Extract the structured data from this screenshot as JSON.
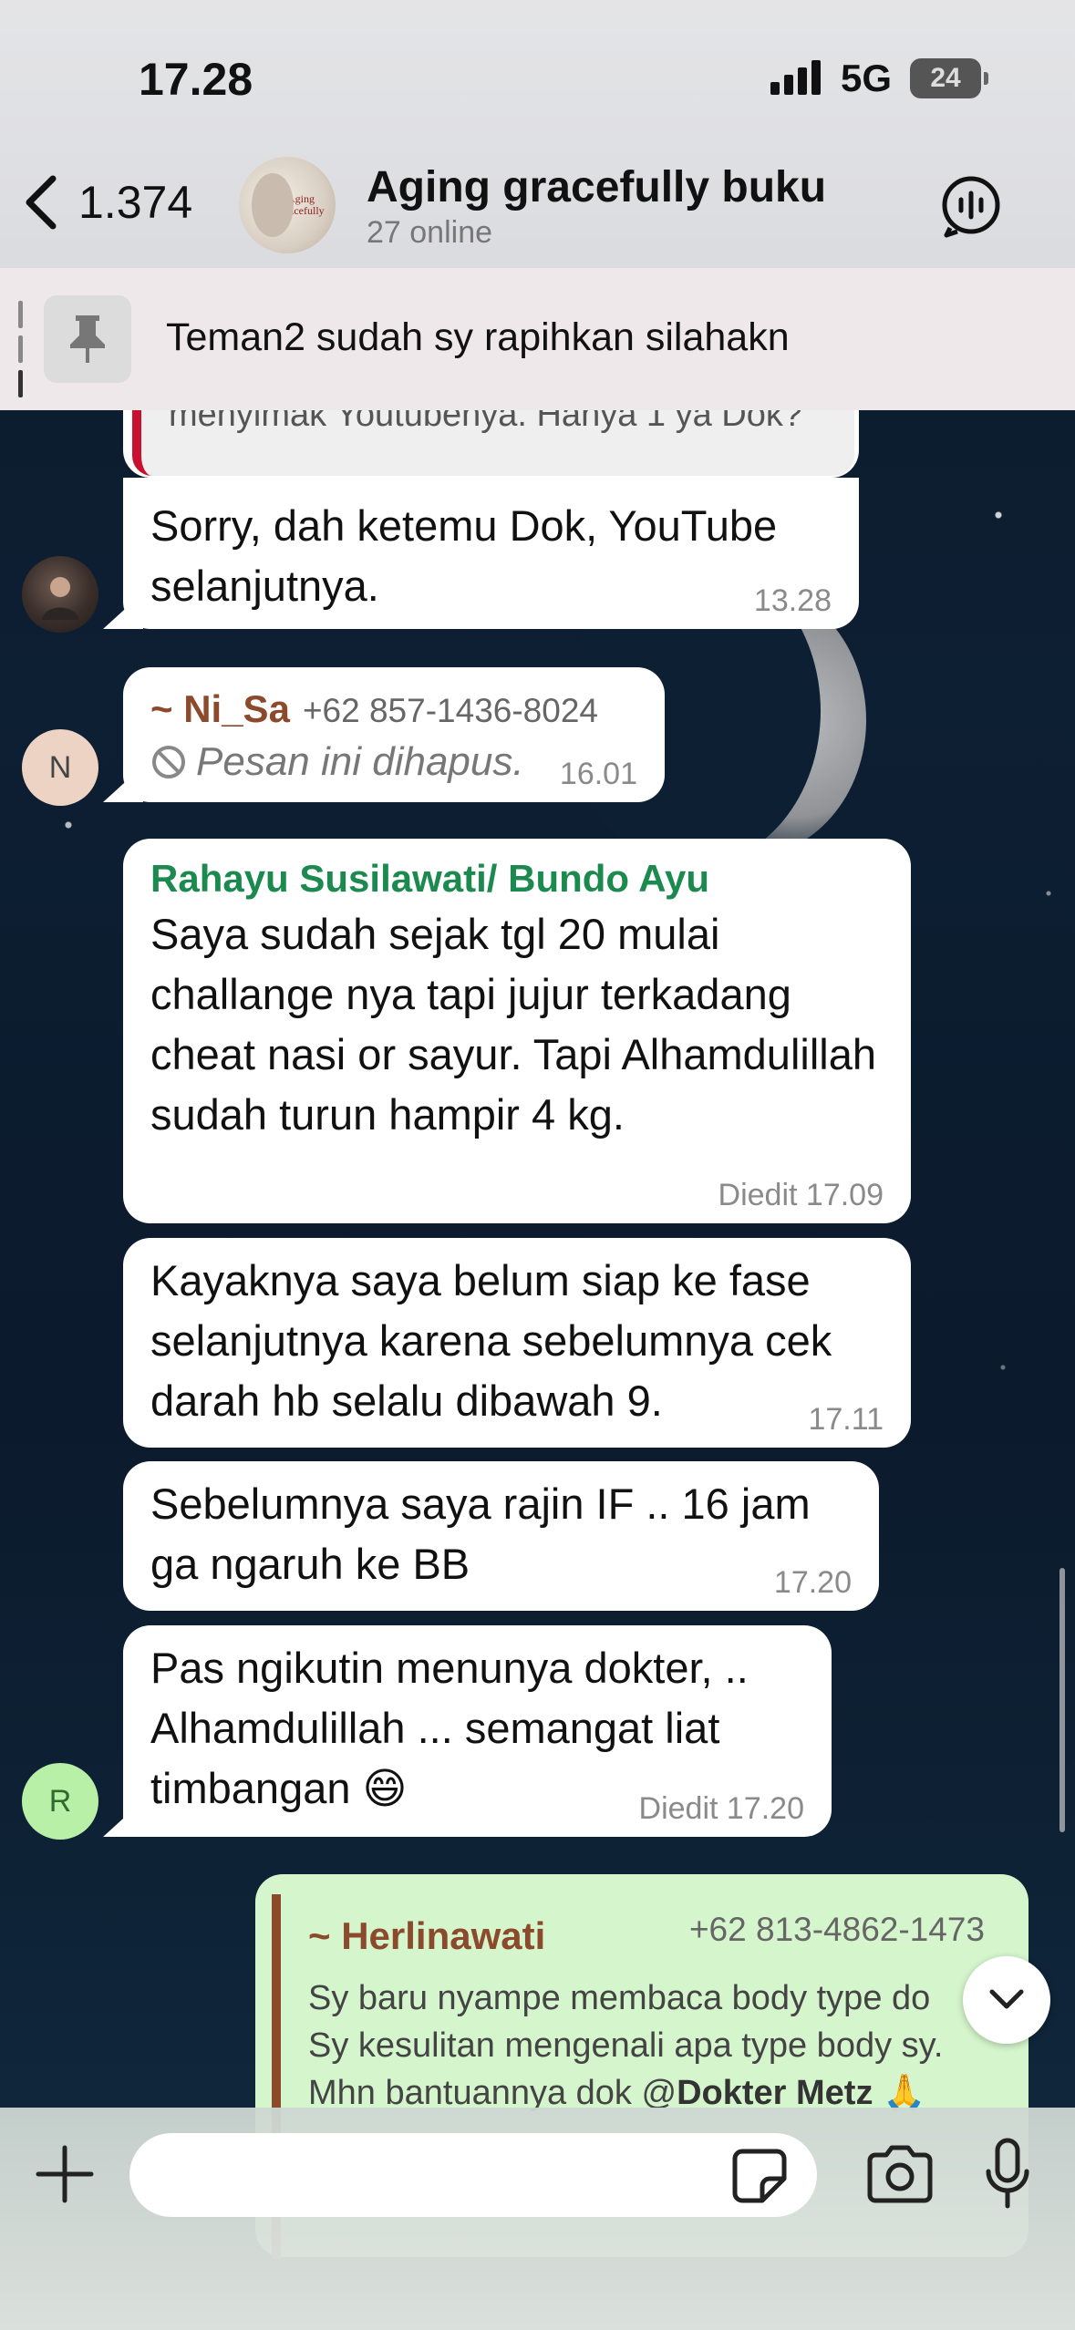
{
  "status_bar": {
    "time": "17.28",
    "network": "5G",
    "battery": "24"
  },
  "header": {
    "back_count": "1.374",
    "group_name": "Aging gracefully buku",
    "online": "27 online",
    "avatar_text": "Aging Gracefully"
  },
  "pinned": {
    "text": "Teman2 sudah sy rapihkan silahakn"
  },
  "messages": [
    {
      "quote_text": "menyimak Youtubenya. Hanya 1 ya Dok?",
      "text": "Sorry, dah ketemu Dok, YouTube selanjutnya.",
      "time": "13.28"
    },
    {
      "sender": "~ Ni_Sa",
      "phone": "+62 857-1436-8024",
      "text": "Pesan ini dihapus.",
      "time": "16.01",
      "avatar_letter": "N"
    },
    {
      "sender": "Rahayu Susilawati/ Bundo Ayu",
      "text": "Saya sudah sejak tgl 20 mulai challange nya tapi jujur terkadang cheat nasi or sayur. Tapi Alhamdulillah sudah turun hampir 4 kg.",
      "time": "Diedit 17.09"
    },
    {
      "text": "Kayaknya saya belum siap ke fase selanjutnya karena sebelumnya cek darah hb selalu dibawah 9.",
      "time": "17.11"
    },
    {
      "text": "Sebelumnya saya rajin IF .. 16 jam ga ngaruh ke BB",
      "time": "17.20"
    },
    {
      "text": "Pas ngikutin menunya dokter, .. Alhamdulillah ... semangat liat timbangan 😄",
      "time": "Diedit 17.20",
      "avatar_letter": "R"
    }
  ],
  "reply": {
    "sender": "~ Herlinawati",
    "phone": "+62 813-4862-1473",
    "line1": "Sy baru nyampe membaca body type do",
    "line2": "Sy kesulitan mengenali apa type body sy.",
    "line3_prefix": "Mhn bantuannya dok @",
    "line3_mention": "Dokter Metz",
    "line3_suffix": " 🙏"
  },
  "composer": {
    "placeholder": ""
  },
  "colors": {
    "sender_green": "#1c8a4e",
    "sender_brown": "#8b4a2b",
    "outgoing_bubble": "#d5f5cc",
    "quote_bar": "#c9102f"
  }
}
